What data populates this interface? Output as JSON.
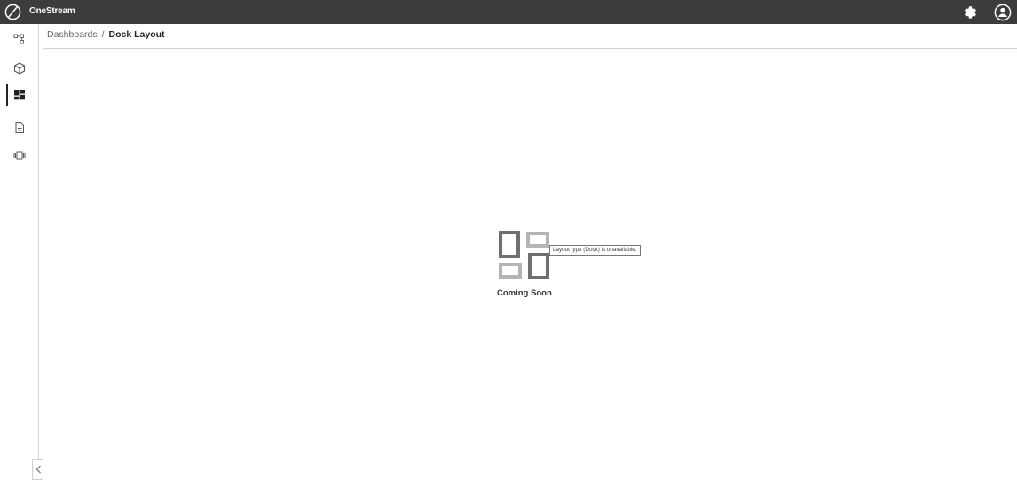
{
  "app": {
    "brand": "OneStream"
  },
  "breadcrumb": {
    "parent": "Dashboards",
    "separator": "/",
    "current": "Dock Layout"
  },
  "sidebar": {
    "items": [
      {
        "name": "hierarchy-icon",
        "active": false
      },
      {
        "name": "cube-icon",
        "active": false
      },
      {
        "name": "dashboard-icon",
        "active": true
      },
      {
        "name": "document-icon",
        "active": false
      },
      {
        "name": "carousel-icon",
        "active": false
      }
    ]
  },
  "placeholder": {
    "title": "Coming Soon",
    "tooltip": "Layout type (Dock) is unavailable."
  },
  "colors": {
    "topbar": "#3c3c3c",
    "icon_dark": "#6f6f6f",
    "icon_light": "#b5b5b5"
  }
}
